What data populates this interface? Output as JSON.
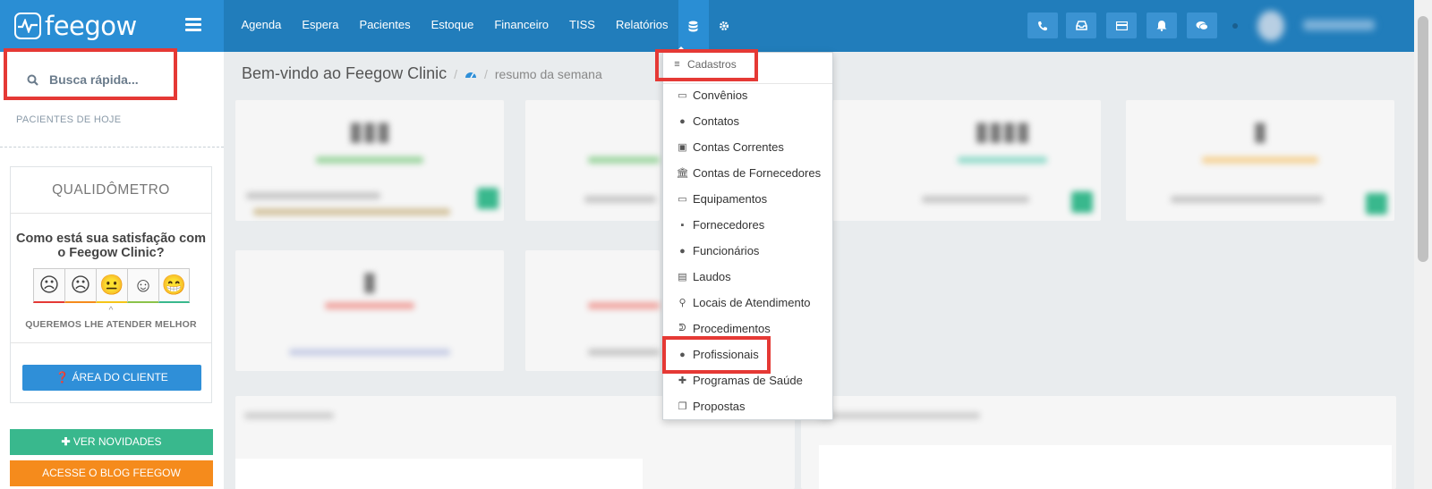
{
  "brand": {
    "name": "feegow"
  },
  "nav": {
    "items": [
      "Agenda",
      "Espera",
      "Pacientes",
      "Estoque",
      "Financeiro",
      "TISS",
      "Relatórios"
    ],
    "icons": [
      "database-icon",
      "gear-icon"
    ]
  },
  "topbar": {
    "buttons": [
      "phone-icon",
      "inbox-icon",
      "card-icon",
      "bell-icon",
      "chat-icon"
    ]
  },
  "sidebar": {
    "search_placeholder": "Busca rápida...",
    "section_label": "PACIENTES DE HOJE",
    "qualidometro": {
      "title": "QUALIDÔMETRO",
      "question": "Como está sua satisfação com o Feegow Clinic?",
      "faces": [
        "☹",
        "☹",
        "😐",
        "☺",
        "😁"
      ],
      "face_colors": [
        "#e53935",
        "#f58b1c",
        "#f5c518",
        "#8bc34a",
        "#39b88d"
      ],
      "subtitle": "QUEREMOS LHE ATENDER MELHOR",
      "button": "ÁREA DO CLIENTE"
    },
    "news_button": "VER NOVIDADES",
    "blog_button": "ACESSE O BLOG FEEGOW"
  },
  "main": {
    "title": "Bem-vindo ao Feegow Clinic",
    "breadcrumb": "resumo da semana"
  },
  "dropdown": {
    "header": "Cadastros",
    "items": [
      {
        "label": "Convênios",
        "icon": "▭"
      },
      {
        "label": "Contatos",
        "icon": "●"
      },
      {
        "label": "Contas Correntes",
        "icon": "▣"
      },
      {
        "label": "Contas de Fornecedores",
        "icon": "🏛"
      },
      {
        "label": "Equipamentos",
        "icon": "▭"
      },
      {
        "label": "Fornecedores",
        "icon": "▪"
      },
      {
        "label": "Funcionários",
        "icon": "●"
      },
      {
        "label": "Laudos",
        "icon": "▤"
      },
      {
        "label": "Locais de Atendimento",
        "icon": "⚲"
      },
      {
        "label": "Procedimentos",
        "icon": "ᕲ"
      },
      {
        "label": "Profissionais",
        "icon": "●"
      },
      {
        "label": "Programas de Saúde",
        "icon": "✚"
      },
      {
        "label": "Propostas",
        "icon": "❐"
      }
    ]
  },
  "colors": {
    "topbar": "#217dbb",
    "highlight": "#e53935",
    "green": "#39b88d",
    "orange": "#f58b1c",
    "blue": "#2f8fd8"
  }
}
